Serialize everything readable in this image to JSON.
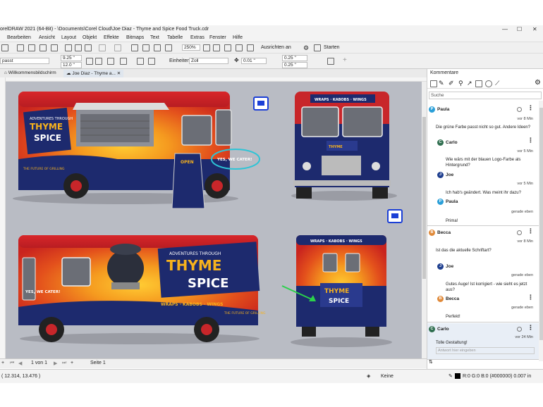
{
  "window": {
    "title": "orelDRAW 2021 (64-Bit) - \\Documents\\Corel Cloud\\Joe Diaz - Thyme and Spice Food Truck.cdr",
    "controls": [
      "—",
      "☐",
      "✕"
    ]
  },
  "menu": [
    "Bearbeiten",
    "Ansicht",
    "Layout",
    "Objekt",
    "Effekte",
    "Bitmaps",
    "Text",
    "Tabelle",
    "Extras",
    "Fenster",
    "Hilfe"
  ],
  "toolbar1": {
    "zoom": "250%",
    "snap_label": "Ausrichten an",
    "start_label": "Starten"
  },
  "toolbar2": {
    "preset": "passt",
    "width": "9.25 \"",
    "height": "12.0 \"",
    "units_label": "Einheiten:",
    "units": "Zoll",
    "nudge": "0.01 \"",
    "dup_x": "0.25 \"",
    "dup_y": "0.25 \""
  },
  "tabs": [
    {
      "label": "Willkommensbildschirm"
    },
    {
      "label": "Joe Diaz - Thyme a..."
    }
  ],
  "pagebar": {
    "page_of": "1  von  1",
    "page_tab": "Seite 1"
  },
  "status": {
    "coords": "( 12.314, 13.476 )",
    "fill_none": "Keine",
    "outline": "R:0 G:0 B:0 (#000000)  0.007 in"
  },
  "artwork": {
    "wraps_text": "WRAPS · KABOBS · WINGS",
    "brand_top": "ADVENTURES THROUGH",
    "brand_thyme": "THYME",
    "brand_and": "AND",
    "brand_spice": "SPICE",
    "future": "THE FUTURE OF GRILLING",
    "cater": "YES, WE CATER!",
    "open": "OPEN",
    "banner": "WRAPS · KABOBS · WINGS"
  },
  "comments_panel": {
    "title": "Kommentare",
    "search_placeholder": "Suche",
    "reply_placeholder": "Antwort hier eingeben",
    "threads": [
      {
        "author": "Paula",
        "initial": "P",
        "color": "#2a9fd8",
        "time": "vor 8 Min",
        "text": "Die grüne Farbe passt nicht so gut. Andere Ideen?",
        "replies": [
          {
            "author": "Carlo",
            "initial": "C",
            "color": "#2f6e4f",
            "time": "vor 5 Min",
            "text": "Wie wärs mit der blauen Logo-Farbe als Hintergrund?"
          },
          {
            "author": "Joe",
            "initial": "J",
            "color": "#1f3f8f",
            "time": "vor 5 Min",
            "text": "Ich hab's geändert. Was meint ihr dazu?"
          },
          {
            "author": "Paula",
            "initial": "P",
            "color": "#2a9fd8",
            "time": "gerade eben",
            "text": "Prima!"
          }
        ]
      },
      {
        "author": "Becca",
        "initial": "B",
        "color": "#e08a3a",
        "time": "vor 8 Min",
        "text": "Ist das die aktuelle Schriftart?",
        "replies": [
          {
            "author": "Joe",
            "initial": "J",
            "color": "#1f3f8f",
            "time": "gerade eben",
            "text": "Gutes Auge! Ist korrigiert - wie sieht es jetzt aus?"
          },
          {
            "author": "Becca",
            "initial": "B",
            "color": "#e08a3a",
            "time": "gerade eben",
            "text": "Perfekt!"
          }
        ]
      },
      {
        "author": "Carlo",
        "initial": "C",
        "color": "#2f6e4f",
        "time": "vor 24 Min",
        "text": "Tolle Gestaltung!",
        "replies": []
      }
    ]
  }
}
